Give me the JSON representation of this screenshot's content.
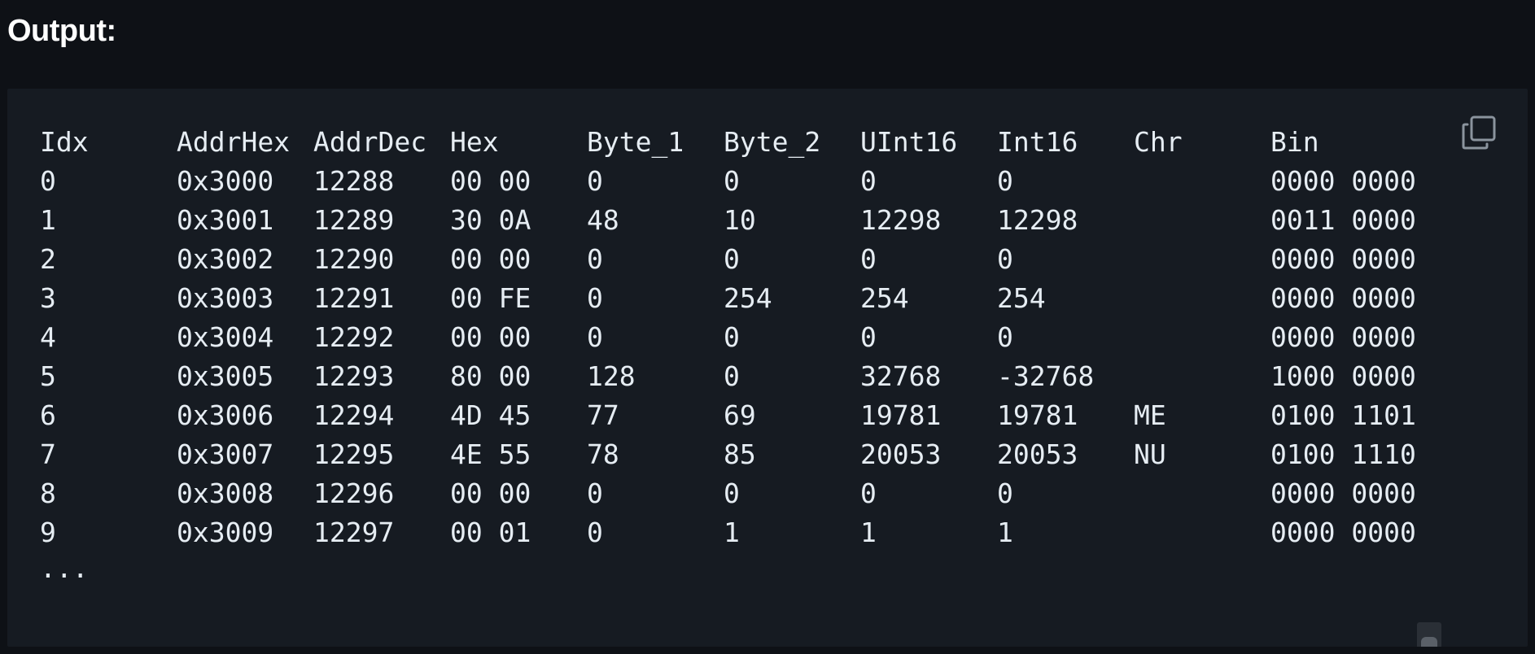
{
  "heading": "Output:",
  "table": {
    "headers": [
      "Idx",
      "AddrHex",
      "AddrDec",
      "Hex",
      "Byte_1",
      "Byte_2",
      "UInt16",
      "Int16",
      "Chr",
      "Bin"
    ],
    "rows": [
      [
        "0",
        "0x3000",
        "12288",
        "00 00",
        "0",
        "0",
        "0",
        "0",
        "",
        "0000 0000"
      ],
      [
        "1",
        "0x3001",
        "12289",
        "30 0A",
        "48",
        "10",
        "12298",
        "12298",
        "",
        "0011 0000"
      ],
      [
        "2",
        "0x3002",
        "12290",
        "00 00",
        "0",
        "0",
        "0",
        "0",
        "",
        "0000 0000"
      ],
      [
        "3",
        "0x3003",
        "12291",
        "00 FE",
        "0",
        "254",
        "254",
        "254",
        "",
        "0000 0000"
      ],
      [
        "4",
        "0x3004",
        "12292",
        "00 00",
        "0",
        "0",
        "0",
        "0",
        "",
        "0000 0000"
      ],
      [
        "5",
        "0x3005",
        "12293",
        "80 00",
        "128",
        "0",
        "32768",
        "-32768",
        "",
        "1000 0000"
      ],
      [
        "6",
        "0x3006",
        "12294",
        "4D 45",
        "77",
        "69",
        "19781",
        "19781",
        "ME",
        "0100 1101"
      ],
      [
        "7",
        "0x3007",
        "12295",
        "4E 55",
        "78",
        "85",
        "20053",
        "20053",
        "NU",
        "0100 1110"
      ],
      [
        "8",
        "0x3008",
        "12296",
        "00 00",
        "0",
        "0",
        "0",
        "0",
        "",
        "0000 0000"
      ],
      [
        "9",
        "0x3009",
        "12297",
        "00 01",
        "0",
        "1",
        "1",
        "1",
        "",
        "0000 0000"
      ]
    ],
    "ellipsis": "..."
  },
  "icons": {
    "copy": "copy-icon"
  },
  "colors": {
    "page_background": "#0e1116",
    "panel_background": "#161b22",
    "text": "#e6edf3",
    "icon": "#8b949e"
  }
}
